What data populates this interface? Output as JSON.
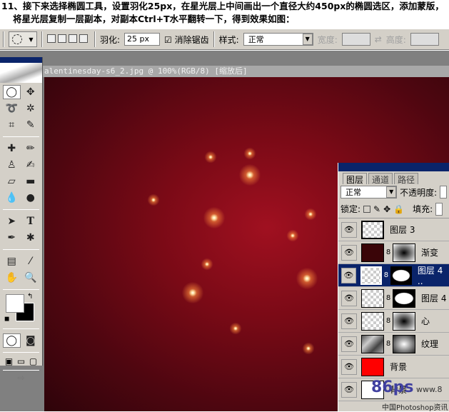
{
  "caption": {
    "line1": "11、接下来选择椭圆工具，设置羽化25px，在星光层上中间画出一个直径大约450px的椭圆选区，添加蒙版，",
    "line2": "将星光层复制一层副本，对副本Ctrl+T水平翻转一下，得到效果如图："
  },
  "options_bar": {
    "feather_label": "羽化:",
    "feather_value": "25 px",
    "antialias_label": "消除锯齿",
    "antialias_checked": true,
    "style_label": "样式:",
    "style_value": "正常",
    "width_label": "宽度:",
    "height_label": "高度:"
  },
  "document": {
    "title": "alentinesday-s6_2.jpg @ 100%(RGB/8) [缩放后]"
  },
  "layers_panel": {
    "tabs": [
      "图层",
      "通道",
      "路径"
    ],
    "blend_mode": "正常",
    "opacity_label": "不透明度:",
    "lock_label": "锁定:",
    "fill_label": "填充:",
    "layers": [
      {
        "name": "图层 3",
        "selected": false
      },
      {
        "name": "渐变",
        "selected": false
      },
      {
        "name": "图层 4 ..",
        "selected": true
      },
      {
        "name": "图层 4",
        "selected": false
      },
      {
        "name": "心",
        "selected": false
      },
      {
        "name": "纹理",
        "selected": false
      },
      {
        "name": "背景",
        "selected": false
      },
      {
        "name": "背景",
        "selected": false
      }
    ]
  },
  "watermark": {
    "logo": "86ps",
    "url": "www.8",
    "site": "中国Photoshop资讯"
  },
  "colors": {
    "canvas": "#7a0a16",
    "selection": "#0a246a",
    "panel": "#d4d0c8"
  }
}
